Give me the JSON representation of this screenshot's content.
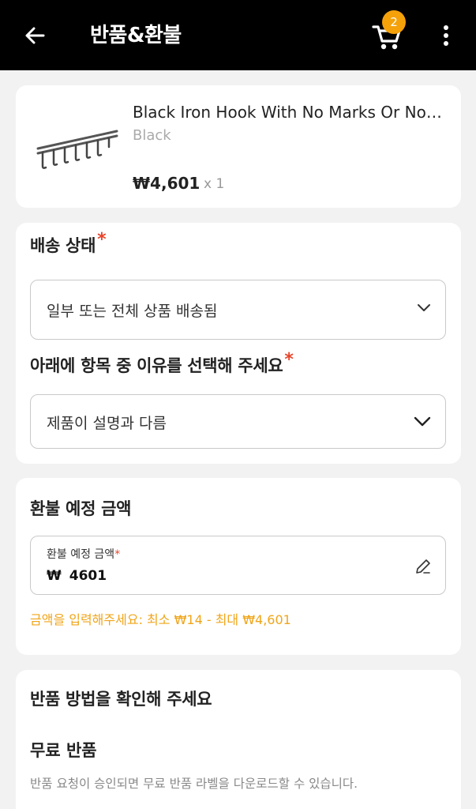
{
  "header": {
    "title": "반품&환불",
    "cart_count": "2"
  },
  "product": {
    "name": "Black Iron Hook With No Marks Or No Holes",
    "variant": "Black",
    "price": "₩4,601",
    "quantity": "x 1"
  },
  "shipping": {
    "label": "배송 상태",
    "required_mark": "*",
    "selected": "일부 또는 전체 상품 배송됨"
  },
  "reason": {
    "label": "아래에 항목 중 이유를 선택해 주세요",
    "required_mark": "*",
    "selected": "제품이 설명과 다름"
  },
  "refund": {
    "section_title": "환불 예정 금액",
    "field_label": "환불 예정 금액",
    "required_mark": "*",
    "currency": "₩",
    "value": "4601",
    "hint": "금액을 입력해주세요: 최소 ₩14 - 최대 ₩4,601"
  },
  "return_method": {
    "section_title": "반품 방법을 확인해 주세요",
    "option_title": "무료 반품",
    "option_desc": "반품 요청이 승인되면 무료 반품 라벨을 다운로드할 수 있습니다."
  },
  "colors": {
    "accent": "#f5a10a",
    "required": "#e8452b",
    "hint": "#f0a51a"
  }
}
